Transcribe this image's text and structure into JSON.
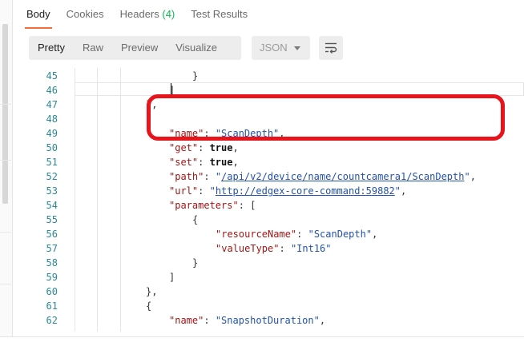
{
  "response_tabs": [
    {
      "label": "Body",
      "count": ""
    },
    {
      "label": "Cookies",
      "count": ""
    },
    {
      "label": "Headers",
      "count": "(4)"
    },
    {
      "label": "Test Results",
      "count": ""
    }
  ],
  "view_modes": [
    "Pretty",
    "Raw",
    "Preview",
    "Visualize"
  ],
  "format": "JSON",
  "colors": {
    "accent": "#f26b3a",
    "highlight": "#e8141b",
    "count": "#0cbb52"
  },
  "lines": [
    {
      "n": "45",
      "tokens": [
        {
          "t": "}",
          "c": "p"
        }
      ]
    },
    {
      "n": "46",
      "tokens": [
        {
          "t": "]",
          "c": "p"
        }
      ]
    },
    {
      "n": "47",
      "tokens": [
        {
          "t": "},",
          "c": "p"
        }
      ]
    },
    {
      "n": "48",
      "tokens": [
        {
          "t": "{",
          "c": "p"
        }
      ]
    },
    {
      "n": "49",
      "tokens": [
        {
          "t": "\"name\"",
          "c": "k"
        },
        {
          "t": ": ",
          "c": "p"
        },
        {
          "t": "\"ScanDepth\"",
          "c": "s"
        },
        {
          "t": ",",
          "c": "p"
        }
      ]
    },
    {
      "n": "50",
      "tokens": [
        {
          "t": "\"get\"",
          "c": "k"
        },
        {
          "t": ": ",
          "c": "p"
        },
        {
          "t": "true",
          "c": "b"
        },
        {
          "t": ",",
          "c": "p"
        }
      ]
    },
    {
      "n": "51",
      "tokens": [
        {
          "t": "\"set\"",
          "c": "k"
        },
        {
          "t": ": ",
          "c": "p"
        },
        {
          "t": "true",
          "c": "b"
        },
        {
          "t": ",",
          "c": "p"
        }
      ]
    },
    {
      "n": "52",
      "tokens": [
        {
          "t": "\"path\"",
          "c": "k"
        },
        {
          "t": ": ",
          "c": "p"
        },
        {
          "t": "\"",
          "c": "s"
        },
        {
          "t": "/api/v2/device/name/countcamera1/ScanDepth",
          "c": "u"
        },
        {
          "t": "\"",
          "c": "s"
        },
        {
          "t": ",",
          "c": "p"
        }
      ]
    },
    {
      "n": "53",
      "tokens": [
        {
          "t": "\"url\"",
          "c": "k"
        },
        {
          "t": ": ",
          "c": "p"
        },
        {
          "t": "\"",
          "c": "s"
        },
        {
          "t": "http://edgex-core-command:59882",
          "c": "u"
        },
        {
          "t": "\"",
          "c": "s"
        },
        {
          "t": ",",
          "c": "p"
        }
      ]
    },
    {
      "n": "54",
      "tokens": [
        {
          "t": "\"parameters\"",
          "c": "k"
        },
        {
          "t": ": [",
          "c": "p"
        }
      ]
    },
    {
      "n": "55",
      "tokens": [
        {
          "t": "{",
          "c": "p"
        }
      ]
    },
    {
      "n": "56",
      "tokens": [
        {
          "t": "\"resourceName\"",
          "c": "k"
        },
        {
          "t": ": ",
          "c": "p"
        },
        {
          "t": "\"ScanDepth\"",
          "c": "s"
        },
        {
          "t": ",",
          "c": "p"
        }
      ]
    },
    {
      "n": "57",
      "tokens": [
        {
          "t": "\"valueType\"",
          "c": "k"
        },
        {
          "t": ": ",
          "c": "p"
        },
        {
          "t": "\"Int16\"",
          "c": "s"
        }
      ]
    },
    {
      "n": "58",
      "tokens": [
        {
          "t": "}",
          "c": "p"
        }
      ]
    },
    {
      "n": "59",
      "tokens": [
        {
          "t": "]",
          "c": "p"
        }
      ]
    },
    {
      "n": "60",
      "tokens": [
        {
          "t": "},",
          "c": "p"
        }
      ]
    },
    {
      "n": "61",
      "tokens": [
        {
          "t": "{",
          "c": "p"
        }
      ]
    },
    {
      "n": "62",
      "tokens": [
        {
          "t": "\"name\"",
          "c": "k"
        },
        {
          "t": ": ",
          "c": "p"
        },
        {
          "t": "\"SnapshotDuration\"",
          "c": "s"
        },
        {
          "t": ",",
          "c": "p"
        }
      ]
    }
  ]
}
